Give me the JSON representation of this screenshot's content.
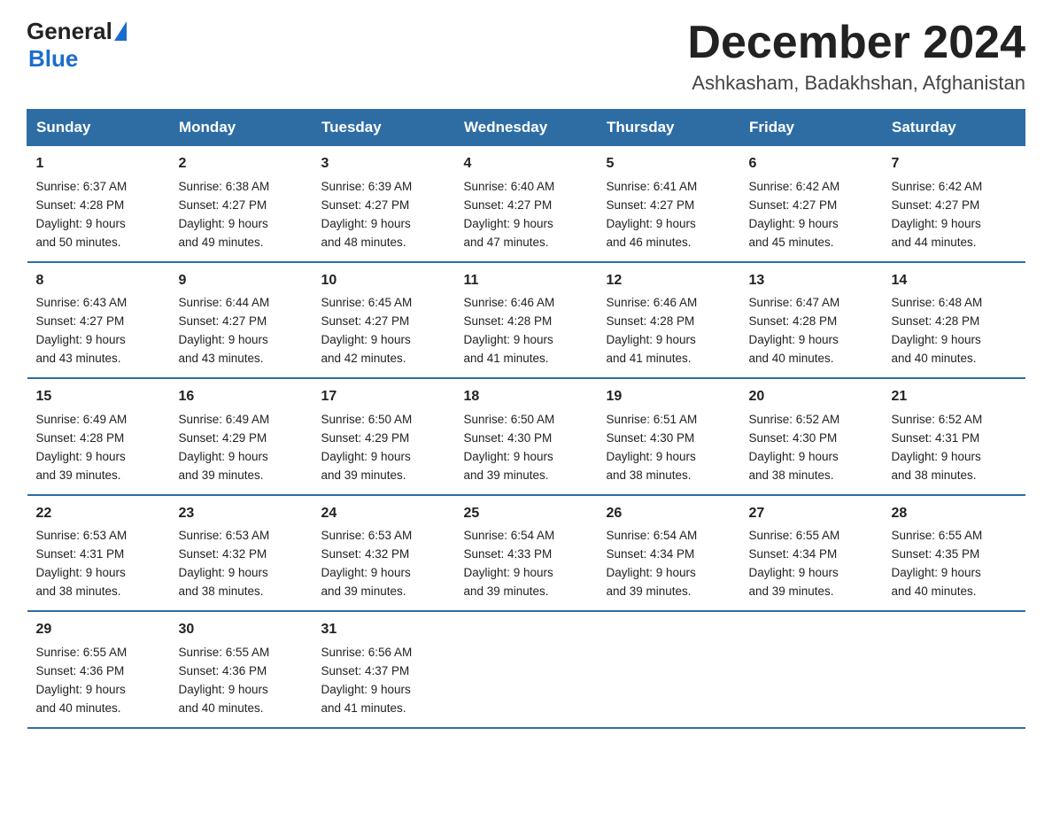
{
  "logo": {
    "general": "General",
    "blue": "Blue"
  },
  "title": "December 2024",
  "location": "Ashkasham, Badakhshan, Afghanistan",
  "weekdays": [
    "Sunday",
    "Monday",
    "Tuesday",
    "Wednesday",
    "Thursday",
    "Friday",
    "Saturday"
  ],
  "weeks": [
    [
      {
        "day": "1",
        "sunrise": "6:37 AM",
        "sunset": "4:28 PM",
        "daylight": "9 hours and 50 minutes."
      },
      {
        "day": "2",
        "sunrise": "6:38 AM",
        "sunset": "4:27 PM",
        "daylight": "9 hours and 49 minutes."
      },
      {
        "day": "3",
        "sunrise": "6:39 AM",
        "sunset": "4:27 PM",
        "daylight": "9 hours and 48 minutes."
      },
      {
        "day": "4",
        "sunrise": "6:40 AM",
        "sunset": "4:27 PM",
        "daylight": "9 hours and 47 minutes."
      },
      {
        "day": "5",
        "sunrise": "6:41 AM",
        "sunset": "4:27 PM",
        "daylight": "9 hours and 46 minutes."
      },
      {
        "day": "6",
        "sunrise": "6:42 AM",
        "sunset": "4:27 PM",
        "daylight": "9 hours and 45 minutes."
      },
      {
        "day": "7",
        "sunrise": "6:42 AM",
        "sunset": "4:27 PM",
        "daylight": "9 hours and 44 minutes."
      }
    ],
    [
      {
        "day": "8",
        "sunrise": "6:43 AM",
        "sunset": "4:27 PM",
        "daylight": "9 hours and 43 minutes."
      },
      {
        "day": "9",
        "sunrise": "6:44 AM",
        "sunset": "4:27 PM",
        "daylight": "9 hours and 43 minutes."
      },
      {
        "day": "10",
        "sunrise": "6:45 AM",
        "sunset": "4:27 PM",
        "daylight": "9 hours and 42 minutes."
      },
      {
        "day": "11",
        "sunrise": "6:46 AM",
        "sunset": "4:28 PM",
        "daylight": "9 hours and 41 minutes."
      },
      {
        "day": "12",
        "sunrise": "6:46 AM",
        "sunset": "4:28 PM",
        "daylight": "9 hours and 41 minutes."
      },
      {
        "day": "13",
        "sunrise": "6:47 AM",
        "sunset": "4:28 PM",
        "daylight": "9 hours and 40 minutes."
      },
      {
        "day": "14",
        "sunrise": "6:48 AM",
        "sunset": "4:28 PM",
        "daylight": "9 hours and 40 minutes."
      }
    ],
    [
      {
        "day": "15",
        "sunrise": "6:49 AM",
        "sunset": "4:28 PM",
        "daylight": "9 hours and 39 minutes."
      },
      {
        "day": "16",
        "sunrise": "6:49 AM",
        "sunset": "4:29 PM",
        "daylight": "9 hours and 39 minutes."
      },
      {
        "day": "17",
        "sunrise": "6:50 AM",
        "sunset": "4:29 PM",
        "daylight": "9 hours and 39 minutes."
      },
      {
        "day": "18",
        "sunrise": "6:50 AM",
        "sunset": "4:30 PM",
        "daylight": "9 hours and 39 minutes."
      },
      {
        "day": "19",
        "sunrise": "6:51 AM",
        "sunset": "4:30 PM",
        "daylight": "9 hours and 38 minutes."
      },
      {
        "day": "20",
        "sunrise": "6:52 AM",
        "sunset": "4:30 PM",
        "daylight": "9 hours and 38 minutes."
      },
      {
        "day": "21",
        "sunrise": "6:52 AM",
        "sunset": "4:31 PM",
        "daylight": "9 hours and 38 minutes."
      }
    ],
    [
      {
        "day": "22",
        "sunrise": "6:53 AM",
        "sunset": "4:31 PM",
        "daylight": "9 hours and 38 minutes."
      },
      {
        "day": "23",
        "sunrise": "6:53 AM",
        "sunset": "4:32 PM",
        "daylight": "9 hours and 38 minutes."
      },
      {
        "day": "24",
        "sunrise": "6:53 AM",
        "sunset": "4:32 PM",
        "daylight": "9 hours and 39 minutes."
      },
      {
        "day": "25",
        "sunrise": "6:54 AM",
        "sunset": "4:33 PM",
        "daylight": "9 hours and 39 minutes."
      },
      {
        "day": "26",
        "sunrise": "6:54 AM",
        "sunset": "4:34 PM",
        "daylight": "9 hours and 39 minutes."
      },
      {
        "day": "27",
        "sunrise": "6:55 AM",
        "sunset": "4:34 PM",
        "daylight": "9 hours and 39 minutes."
      },
      {
        "day": "28",
        "sunrise": "6:55 AM",
        "sunset": "4:35 PM",
        "daylight": "9 hours and 40 minutes."
      }
    ],
    [
      {
        "day": "29",
        "sunrise": "6:55 AM",
        "sunset": "4:36 PM",
        "daylight": "9 hours and 40 minutes."
      },
      {
        "day": "30",
        "sunrise": "6:55 AM",
        "sunset": "4:36 PM",
        "daylight": "9 hours and 40 minutes."
      },
      {
        "day": "31",
        "sunrise": "6:56 AM",
        "sunset": "4:37 PM",
        "daylight": "9 hours and 41 minutes."
      },
      null,
      null,
      null,
      null
    ]
  ],
  "labels": {
    "sunrise": "Sunrise:",
    "sunset": "Sunset:",
    "daylight": "Daylight:"
  }
}
